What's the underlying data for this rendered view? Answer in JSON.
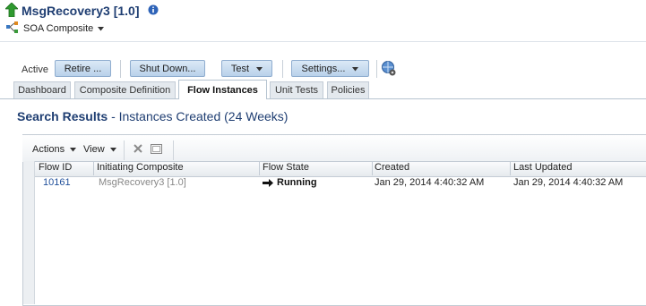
{
  "header": {
    "title": "MsgRecovery3 [1.0]",
    "subtitle": "SOA Composite"
  },
  "toolbar": {
    "state": "Active",
    "retire": "Retire ...",
    "shutdown": "Shut Down...",
    "test": "Test",
    "settings": "Settings..."
  },
  "tabs": [
    {
      "label": "Dashboard"
    },
    {
      "label": "Composite Definition"
    },
    {
      "label": "Flow Instances",
      "active": true
    },
    {
      "label": "Unit Tests"
    },
    {
      "label": "Policies"
    }
  ],
  "search": {
    "heading_bold": "Search Results",
    "heading_rest": "- Instances Created (24 Weeks)"
  },
  "grid_toolbar": {
    "actions": "Actions",
    "view": "View"
  },
  "table": {
    "columns": [
      "Flow ID",
      "Initiating Composite",
      "Flow State",
      "Created",
      "Last Updated"
    ],
    "rows": [
      {
        "flow_id": "10161",
        "composite": "MsgRecovery3 [1.0]",
        "state": "Running",
        "created": "Jan 29, 2014 4:40:32 AM",
        "updated": "Jan 29, 2014 4:40:32 AM"
      }
    ]
  },
  "icons": {
    "title": "green-up-arrow-icon",
    "info": "info-icon",
    "composite": "soa-composite-icon",
    "settings_extra": "globe-gear-icon",
    "detach": "close-x-icon",
    "freeze": "freeze-panel-icon",
    "state": "right-arrow-icon"
  },
  "colors": {
    "title": "#1f3e72",
    "link": "#1f4f9a",
    "button_top": "#dbe9f6",
    "button_bottom": "#b9d1ea"
  }
}
